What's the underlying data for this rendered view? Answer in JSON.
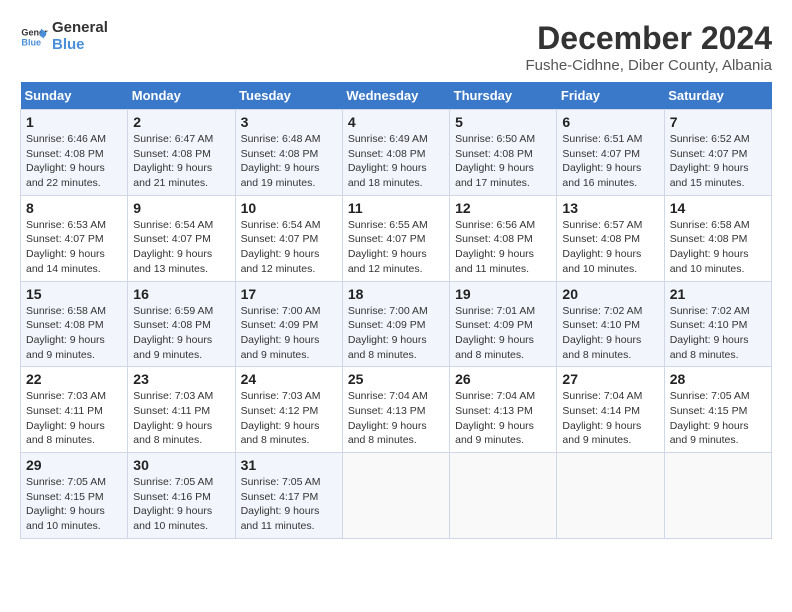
{
  "logo": {
    "line1": "General",
    "line2": "Blue"
  },
  "title": "December 2024",
  "subtitle": "Fushe-Cidhne, Diber County, Albania",
  "days_of_week": [
    "Sunday",
    "Monday",
    "Tuesday",
    "Wednesday",
    "Thursday",
    "Friday",
    "Saturday"
  ],
  "weeks": [
    [
      {
        "day": "1",
        "sunrise": "6:46 AM",
        "sunset": "4:08 PM",
        "daylight": "9 hours and 22 minutes."
      },
      {
        "day": "2",
        "sunrise": "6:47 AM",
        "sunset": "4:08 PM",
        "daylight": "9 hours and 21 minutes."
      },
      {
        "day": "3",
        "sunrise": "6:48 AM",
        "sunset": "4:08 PM",
        "daylight": "9 hours and 19 minutes."
      },
      {
        "day": "4",
        "sunrise": "6:49 AM",
        "sunset": "4:08 PM",
        "daylight": "9 hours and 18 minutes."
      },
      {
        "day": "5",
        "sunrise": "6:50 AM",
        "sunset": "4:08 PM",
        "daylight": "9 hours and 17 minutes."
      },
      {
        "day": "6",
        "sunrise": "6:51 AM",
        "sunset": "4:07 PM",
        "daylight": "9 hours and 16 minutes."
      },
      {
        "day": "7",
        "sunrise": "6:52 AM",
        "sunset": "4:07 PM",
        "daylight": "9 hours and 15 minutes."
      }
    ],
    [
      {
        "day": "8",
        "sunrise": "6:53 AM",
        "sunset": "4:07 PM",
        "daylight": "9 hours and 14 minutes."
      },
      {
        "day": "9",
        "sunrise": "6:54 AM",
        "sunset": "4:07 PM",
        "daylight": "9 hours and 13 minutes."
      },
      {
        "day": "10",
        "sunrise": "6:54 AM",
        "sunset": "4:07 PM",
        "daylight": "9 hours and 12 minutes."
      },
      {
        "day": "11",
        "sunrise": "6:55 AM",
        "sunset": "4:07 PM",
        "daylight": "9 hours and 12 minutes."
      },
      {
        "day": "12",
        "sunrise": "6:56 AM",
        "sunset": "4:08 PM",
        "daylight": "9 hours and 11 minutes."
      },
      {
        "day": "13",
        "sunrise": "6:57 AM",
        "sunset": "4:08 PM",
        "daylight": "9 hours and 10 minutes."
      },
      {
        "day": "14",
        "sunrise": "6:58 AM",
        "sunset": "4:08 PM",
        "daylight": "9 hours and 10 minutes."
      }
    ],
    [
      {
        "day": "15",
        "sunrise": "6:58 AM",
        "sunset": "4:08 PM",
        "daylight": "9 hours and 9 minutes."
      },
      {
        "day": "16",
        "sunrise": "6:59 AM",
        "sunset": "4:08 PM",
        "daylight": "9 hours and 9 minutes."
      },
      {
        "day": "17",
        "sunrise": "7:00 AM",
        "sunset": "4:09 PM",
        "daylight": "9 hours and 9 minutes."
      },
      {
        "day": "18",
        "sunrise": "7:00 AM",
        "sunset": "4:09 PM",
        "daylight": "9 hours and 8 minutes."
      },
      {
        "day": "19",
        "sunrise": "7:01 AM",
        "sunset": "4:09 PM",
        "daylight": "9 hours and 8 minutes."
      },
      {
        "day": "20",
        "sunrise": "7:02 AM",
        "sunset": "4:10 PM",
        "daylight": "9 hours and 8 minutes."
      },
      {
        "day": "21",
        "sunrise": "7:02 AM",
        "sunset": "4:10 PM",
        "daylight": "9 hours and 8 minutes."
      }
    ],
    [
      {
        "day": "22",
        "sunrise": "7:03 AM",
        "sunset": "4:11 PM",
        "daylight": "9 hours and 8 minutes."
      },
      {
        "day": "23",
        "sunrise": "7:03 AM",
        "sunset": "4:11 PM",
        "daylight": "9 hours and 8 minutes."
      },
      {
        "day": "24",
        "sunrise": "7:03 AM",
        "sunset": "4:12 PM",
        "daylight": "9 hours and 8 minutes."
      },
      {
        "day": "25",
        "sunrise": "7:04 AM",
        "sunset": "4:13 PM",
        "daylight": "9 hours and 8 minutes."
      },
      {
        "day": "26",
        "sunrise": "7:04 AM",
        "sunset": "4:13 PM",
        "daylight": "9 hours and 9 minutes."
      },
      {
        "day": "27",
        "sunrise": "7:04 AM",
        "sunset": "4:14 PM",
        "daylight": "9 hours and 9 minutes."
      },
      {
        "day": "28",
        "sunrise": "7:05 AM",
        "sunset": "4:15 PM",
        "daylight": "9 hours and 9 minutes."
      }
    ],
    [
      {
        "day": "29",
        "sunrise": "7:05 AM",
        "sunset": "4:15 PM",
        "daylight": "9 hours and 10 minutes."
      },
      {
        "day": "30",
        "sunrise": "7:05 AM",
        "sunset": "4:16 PM",
        "daylight": "9 hours and 10 minutes."
      },
      {
        "day": "31",
        "sunrise": "7:05 AM",
        "sunset": "4:17 PM",
        "daylight": "9 hours and 11 minutes."
      },
      null,
      null,
      null,
      null
    ]
  ]
}
